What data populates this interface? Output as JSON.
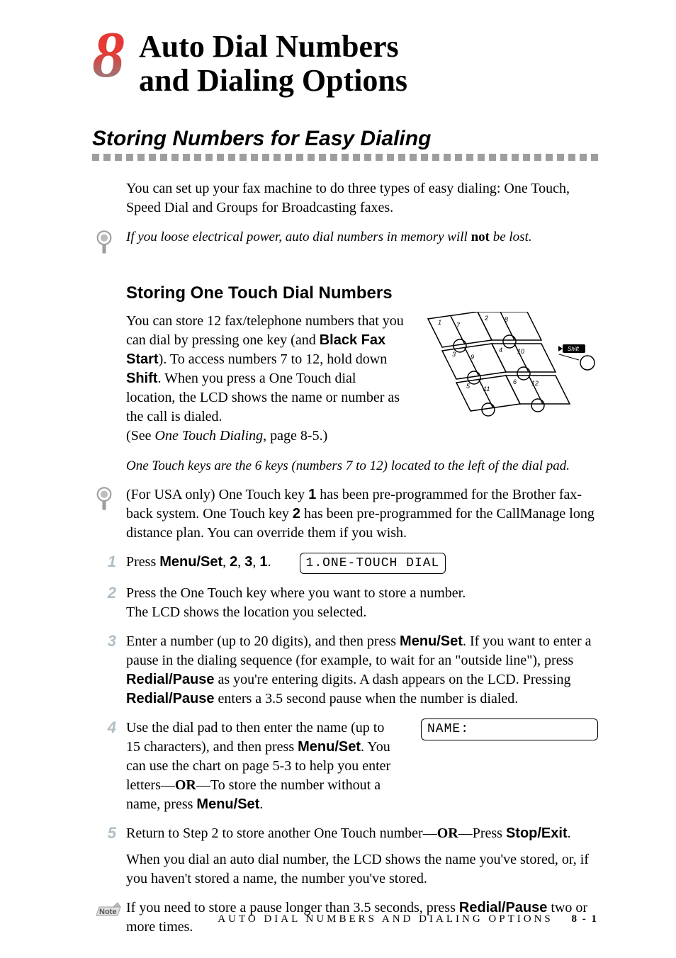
{
  "chapter": {
    "number": "8",
    "title_line1": "Auto Dial Numbers",
    "title_line2": "and Dialing Options"
  },
  "section": {
    "title": "Storing Numbers for Easy Dialing",
    "intro": "You can set up your fax machine to do three types of easy dialing:  One Touch, Speed Dial and Groups for Broadcasting faxes.",
    "power_tip_pre": "If you loose electrical power, auto dial numbers in memory will ",
    "power_tip_bold": "not",
    "power_tip_post": " be lost."
  },
  "subsection": {
    "title": "Storing One Touch Dial Numbers",
    "text_p1": "You can store 12 fax/telephone numbers that you can dial by pressing one key (and ",
    "text_bold1": "Black Fax Start",
    "text_p2": "). To access numbers 7 to 12, hold down ",
    "text_bold2": "Shift",
    "text_p3": ". When you press a One Touch dial location, the LCD shows the name or number as the call is dialed.",
    "see_ref": "One Touch Dialing",
    "see_page": ", page 8-5.)",
    "see_pre": "(See ",
    "keys_italic": "One Touch keys are the 6 keys (numbers 7 to 12) located to the left of the dial pad.",
    "usa_pre": "(For USA only) One Touch key ",
    "usa_k1": "1",
    "usa_mid1": " has been pre-programmed for the Brother fax-back system. One Touch key ",
    "usa_k2": "2",
    "usa_mid2": " has been pre-programmed for the CallManage long distance plan. You can override them if you wish."
  },
  "keypad": {
    "keys": [
      "1",
      "2",
      "7",
      "8",
      "3",
      "4",
      "9",
      "10",
      "5",
      "6",
      "11",
      "12"
    ],
    "shift_label": "Shift"
  },
  "steps": {
    "s1": {
      "num": "1",
      "pre": "Press ",
      "b1": "Menu/Set",
      "mid1": ", ",
      "b2": "2",
      "mid2": ", ",
      "b3": "3",
      "mid3": ", ",
      "b4": "1",
      "end": ".",
      "lcd": "1.ONE-TOUCH DIAL"
    },
    "s2": {
      "num": "2",
      "text": "Press the One Touch key where you want to store a number.",
      "text2": "The LCD shows the location you selected."
    },
    "s3": {
      "num": "3",
      "p1": "Enter a number (up to 20 digits), and then press ",
      "b1": "Menu/Set",
      "p2": ". If you want to enter a pause in the dialing sequence (for example, to wait for an \"outside line\"), press ",
      "b2": "Redial/Pause",
      "p3": " as you're entering digits. A dash appears on the LCD. Pressing ",
      "b3": "Redial/Pause",
      "p4": " enters a 3.5 second pause when the number is dialed."
    },
    "s4": {
      "num": "4",
      "p1": "Use the dial pad to then enter the name (up to 15 characters), and then press ",
      "b1": "Menu/Set",
      "p2": ". You can use the chart on page 5-3 to help you enter letters—",
      "or": "OR",
      "p3": "—To store the number without a name, press ",
      "b2": "Menu/Set",
      "p4": ".",
      "lcd": "NAME:"
    },
    "s5": {
      "num": "5",
      "p1": "Return to Step 2 to store another One Touch number—",
      "or": "OR",
      "p2": "—Press ",
      "b1": "Stop/Exit",
      "p3": ".",
      "para2": "When you dial an auto dial number, the LCD shows the name you've stored, or, if you haven't stored a name, the number you've stored."
    }
  },
  "note": {
    "label": "Note",
    "p1": "If you need to store a pause longer than 3.5 seconds, press ",
    "b1": "Redial/Pause",
    "p2": " two or more times."
  },
  "footer": {
    "text": "AUTO DIAL NUMBERS AND DIALING OPTIONS",
    "page": "8 - 1"
  }
}
